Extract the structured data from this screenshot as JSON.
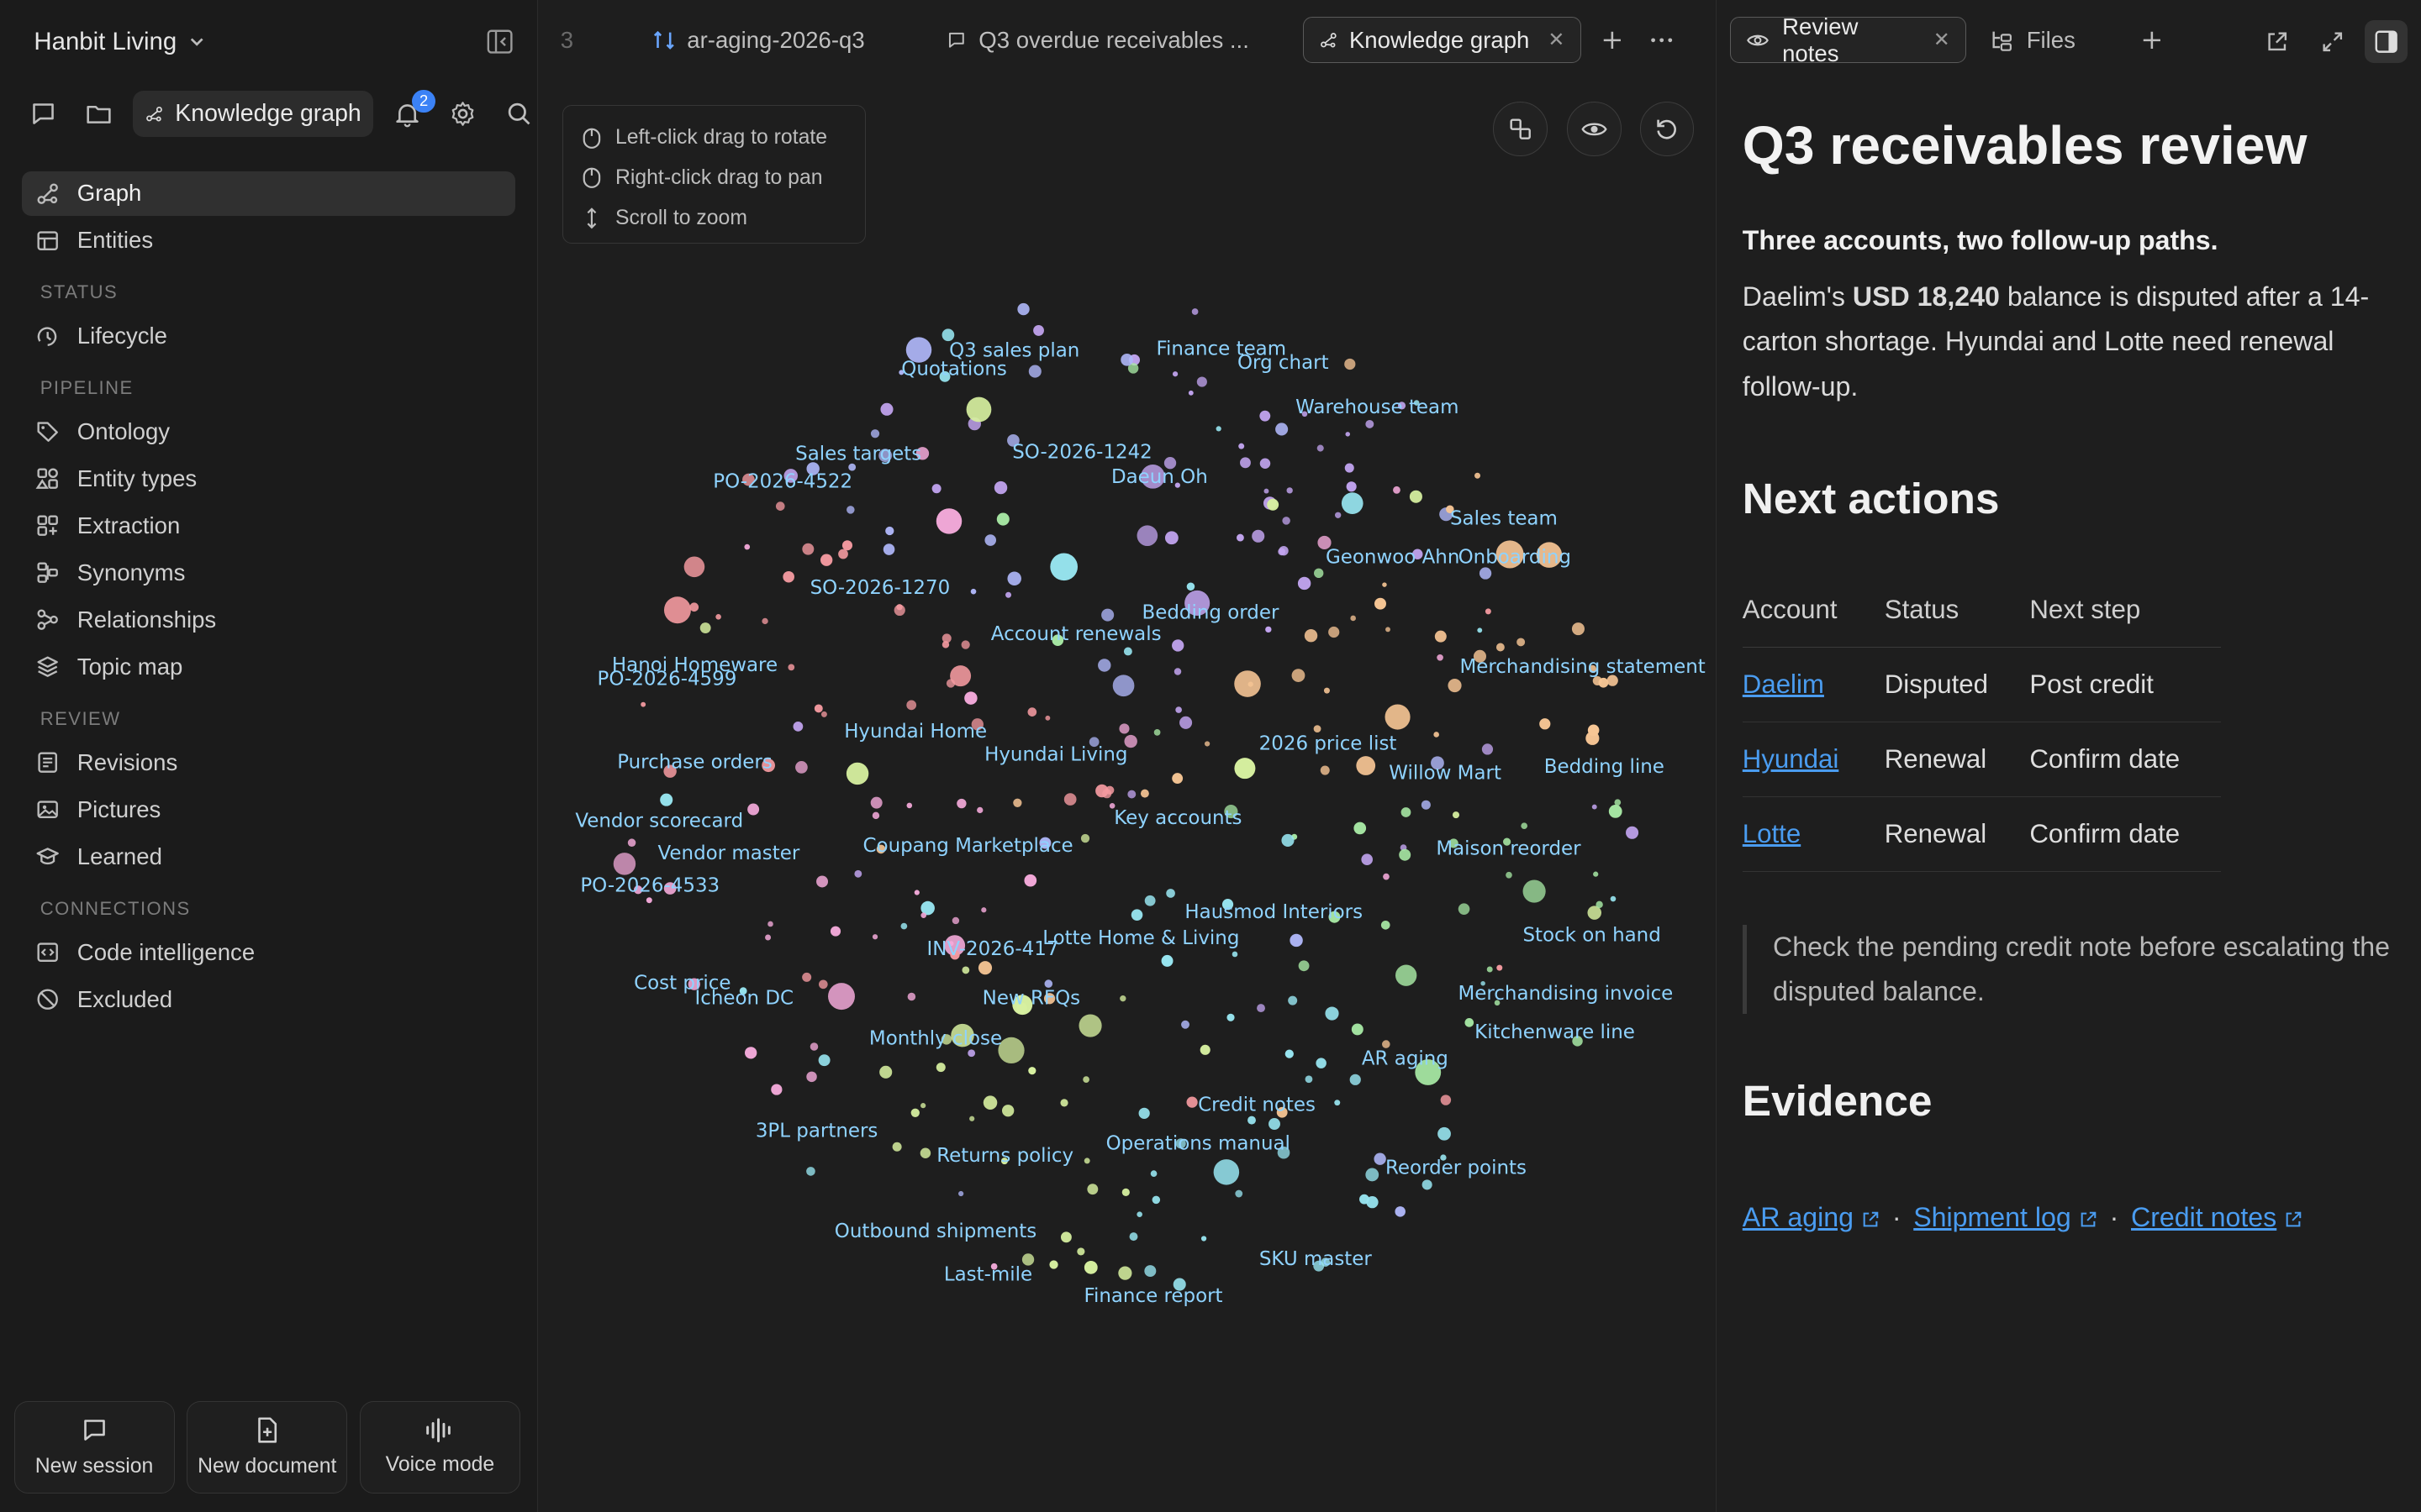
{
  "workspace": {
    "name": "Hanbit Living"
  },
  "quickbar": {
    "active_label": "Knowledge graph",
    "notification_count": "2"
  },
  "nav": {
    "top": [
      {
        "label": "Graph",
        "icon": "graph-icon",
        "active": true
      },
      {
        "label": "Entities",
        "icon": "table-icon",
        "active": false
      }
    ],
    "sections": [
      {
        "title": "STATUS",
        "items": [
          {
            "label": "Lifecycle",
            "icon": "lifecycle-icon"
          }
        ]
      },
      {
        "title": "PIPELINE",
        "items": [
          {
            "label": "Ontology",
            "icon": "tag-icon"
          },
          {
            "label": "Entity types",
            "icon": "shapes-icon"
          },
          {
            "label": "Extraction",
            "icon": "extract-icon"
          },
          {
            "label": "Synonyms",
            "icon": "synonyms-icon"
          },
          {
            "label": "Relationships",
            "icon": "relationships-icon"
          },
          {
            "label": "Topic map",
            "icon": "layers-icon"
          }
        ]
      },
      {
        "title": "REVIEW",
        "items": [
          {
            "label": "Revisions",
            "icon": "revisions-icon"
          },
          {
            "label": "Pictures",
            "icon": "pictures-icon"
          },
          {
            "label": "Learned",
            "icon": "learned-icon"
          }
        ]
      },
      {
        "title": "CONNECTIONS",
        "items": [
          {
            "label": "Code intelligence",
            "icon": "code-icon"
          },
          {
            "label": "Excluded",
            "icon": "excluded-icon"
          }
        ]
      }
    ]
  },
  "bottom_buttons": {
    "new_session": "New session",
    "new_document": "New document",
    "voice_mode": "Voice mode"
  },
  "tabs": {
    "partial": "3",
    "tab1": "ar-aging-2026-q3",
    "tab2": "Q3 overdue receivables ...",
    "tab3": "Knowledge graph"
  },
  "graph_help": {
    "rotate": "Left-click drag to rotate",
    "pan": "Right-click drag to pan",
    "zoom": "Scroll to zoom"
  },
  "graph": {
    "labels": [
      "Q3 sales plan",
      "Finance team",
      "Org chart",
      "Quotations",
      "Warehouse team",
      "Sales targets",
      "SO-2026-1242",
      "PO-2026-4522",
      "Daeun Oh",
      "Sales team",
      "Geonwoo Ahn",
      "Onboarding",
      "SO-2026-1270",
      "Bedding order",
      "Account renewals",
      "Merchandising statement",
      "Hanoi Homeware",
      "PO-2026-4599",
      "Hyundai Home",
      "Hyundai Living",
      "2026 price list",
      "Willow Mart",
      "Bedding line",
      "Purchase orders",
      "Key accounts",
      "Vendor scorecard",
      "Coupang Marketplace",
      "Maison reorder",
      "Vendor master",
      "PO-2026-4533",
      "Hausmod Interiors",
      "Stock on hand",
      "INV-2026-417",
      "Lotte Home & Living",
      "Cost price",
      "Merchandising invoice",
      "Icheon DC",
      "New RFQs",
      "Kitchenware line",
      "Monthly close",
      "AR aging",
      "Credit notes",
      "3PL partners",
      "Operations manual",
      "Returns policy",
      "Reorder points",
      "Outbound shipments",
      "SKU master",
      "Last-mile",
      "Finance report"
    ]
  },
  "right_tabs": {
    "review_notes": "Review notes",
    "files": "Files"
  },
  "doc": {
    "title": "Q3 receivables review",
    "lede": "Three accounts, two follow-up paths.",
    "body_pre": "Daelim's ",
    "body_bold": "USD 18,240",
    "body_post": " balance is disputed after a 14-carton shortage. Hyundai and Lotte need renewal follow-up.",
    "next_actions_heading": "Next actions",
    "table_headers": [
      "Account",
      "Status",
      "Next step"
    ],
    "table_rows": [
      {
        "account": "Daelim",
        "status": "Disputed",
        "next": "Post credit"
      },
      {
        "account": "Hyundai",
        "status": "Renewal",
        "next": "Confirm date"
      },
      {
        "account": "Lotte",
        "status": "Renewal",
        "next": "Confirm date"
      }
    ],
    "quote": "Check the pending credit note before escalating the disputed balance.",
    "evidence_heading": "Evidence",
    "evidence_links": [
      "AR aging",
      "Shipment log",
      "Credit notes"
    ]
  },
  "colors": {
    "accent": "#3b82f6",
    "link": "#4a9cf0",
    "graph_label": "#8fd3ff"
  }
}
